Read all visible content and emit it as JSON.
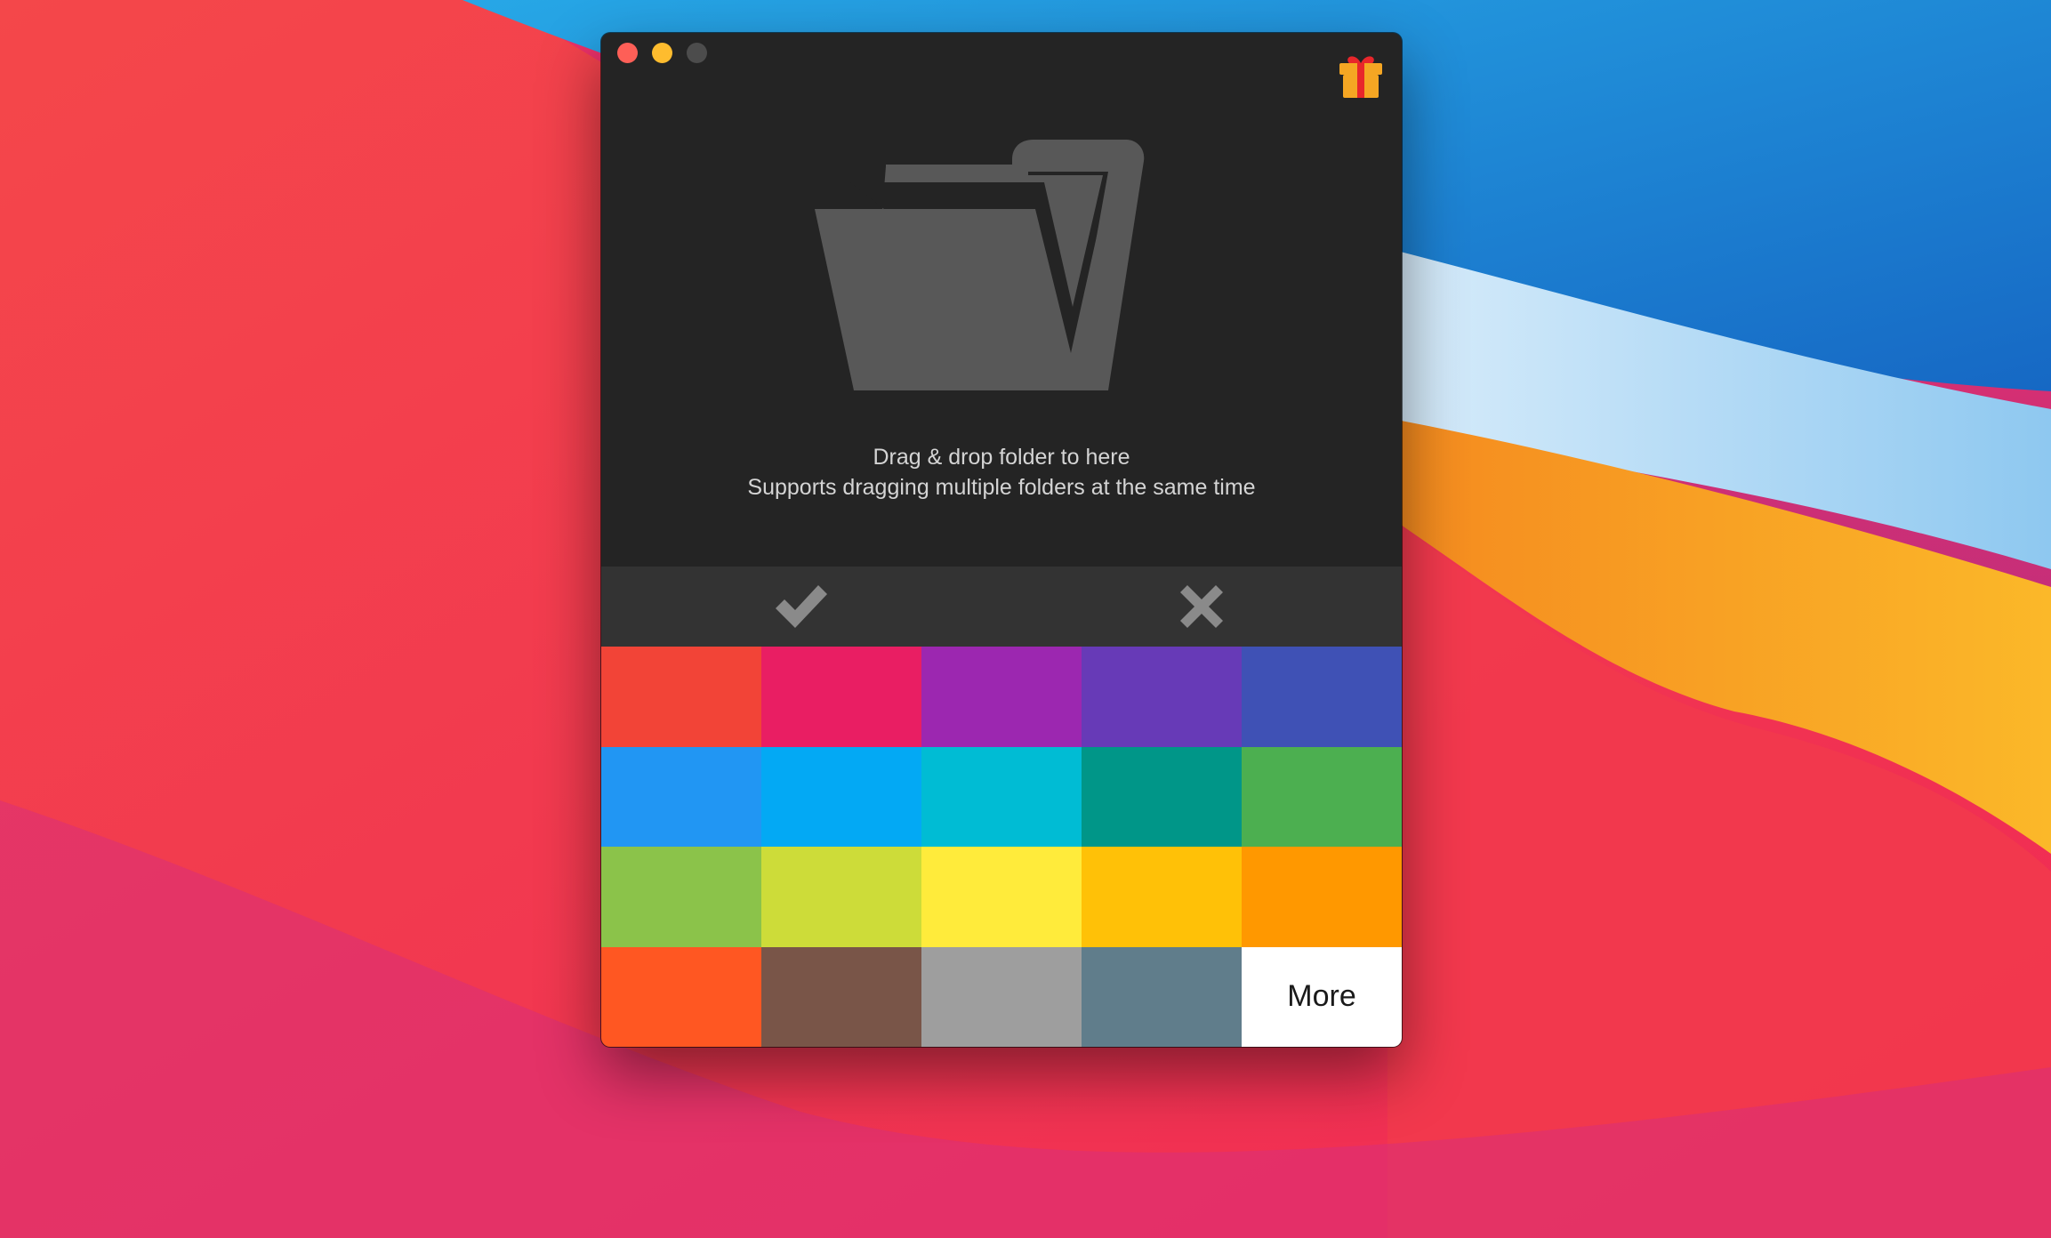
{
  "wallpaper": {
    "colors": {
      "red": "#f2324a",
      "pink": "#f43c6c",
      "magenta": "#b62a8a",
      "blue": "#1d7fd8",
      "light_blue": "#bde3f7",
      "orange": "#f7a81c"
    }
  },
  "window": {
    "traffic_lights": {
      "close_color": "#fe5f57",
      "minimize_color": "#febc2e",
      "zoom_color": "#4c4c4c"
    },
    "gift_icon": "gift-icon",
    "drop_zone": {
      "folder_icon": "folder-open-icon",
      "line1": "Drag & drop folder to here",
      "line2": "Supports dragging multiple folders at the same time"
    },
    "actions": {
      "confirm_icon": "checkmark-icon",
      "cancel_icon": "x-icon"
    },
    "colors": [
      {
        "name": "red",
        "hex": "#f24437"
      },
      {
        "name": "pink",
        "hex": "#e91e63"
      },
      {
        "name": "purple",
        "hex": "#9c27b0"
      },
      {
        "name": "deep-purple",
        "hex": "#673ab7"
      },
      {
        "name": "indigo",
        "hex": "#3f51b5"
      },
      {
        "name": "blue",
        "hex": "#2196f3"
      },
      {
        "name": "light-blue",
        "hex": "#03a9f4"
      },
      {
        "name": "cyan",
        "hex": "#00bcd4"
      },
      {
        "name": "teal",
        "hex": "#009688"
      },
      {
        "name": "green",
        "hex": "#4caf50"
      },
      {
        "name": "light-green",
        "hex": "#8bc34a"
      },
      {
        "name": "lime",
        "hex": "#cddc39"
      },
      {
        "name": "yellow",
        "hex": "#ffeb3b"
      },
      {
        "name": "amber",
        "hex": "#ffc107"
      },
      {
        "name": "orange",
        "hex": "#ff9800"
      },
      {
        "name": "deep-orange",
        "hex": "#ff5722"
      },
      {
        "name": "brown",
        "hex": "#795548"
      },
      {
        "name": "grey",
        "hex": "#9e9e9e"
      },
      {
        "name": "blue-grey",
        "hex": "#607d8b"
      }
    ],
    "more_label": "More"
  }
}
